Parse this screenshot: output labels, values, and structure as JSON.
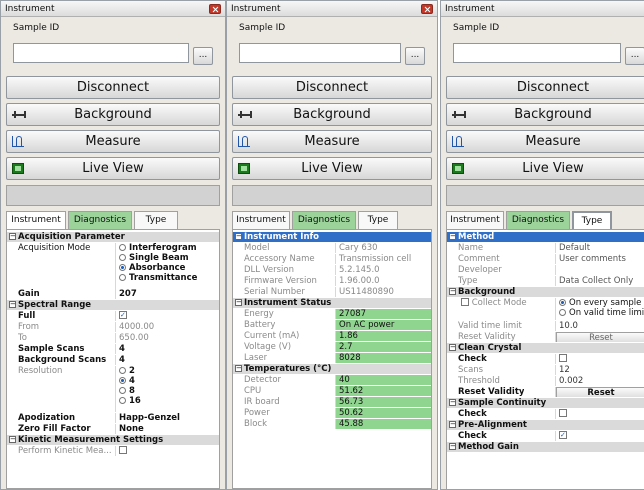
{
  "window_title": "Instrument",
  "sample_id_label": "Sample ID",
  "sample_id_value": "",
  "browse_label": "...",
  "buttons": {
    "disconnect": "Disconnect",
    "background": "Background",
    "measure": "Measure",
    "live_view": "Live View"
  },
  "tabs": {
    "instrument": "Instrument",
    "diagnostics": "Diagnostics",
    "type": "Type"
  },
  "panel1": {
    "acq_param": "Acquisition Parameter",
    "acq_mode": "Acquisition Mode",
    "mode_options": [
      "Interferogram",
      "Single Beam",
      "Absorbance",
      "Transmittance"
    ],
    "gain_label": "Gain",
    "gain_value": "207",
    "spectral_range": "Spectral Range",
    "full_label": "Full",
    "from_label": "From",
    "from_value": "4000.00",
    "to_label": "To",
    "to_value": "650.00",
    "sample_scans_label": "Sample Scans",
    "sample_scans_value": "4",
    "background_scans_label": "Background Scans",
    "background_scans_value": "4",
    "resolution_label": "Resolution",
    "resolution_options": [
      "2",
      "4",
      "8",
      "16"
    ],
    "apodization_label": "Apodization",
    "apodization_value": "Happ-Genzel",
    "zero_fill_label": "Zero Fill Factor",
    "zero_fill_value": "None",
    "kinetic": "Kinetic Measurement Settings",
    "perform_kinetic": "Perform Kinetic Mea..."
  },
  "panel2": {
    "instrument_info": "Instrument Info",
    "model_label": "Model",
    "model_value": "Cary 630",
    "accessory_label": "Accessory Name",
    "accessory_value": "Transmission cell",
    "dll_label": "DLL Version",
    "dll_value": "5.2.145.0",
    "firmware_label": "Firmware Version",
    "firmware_value": "1.96.00.0",
    "serial_label": "Serial Number",
    "serial_value": "US11480890",
    "instrument_status": "Instrument Status",
    "energy_label": "Energy",
    "energy_value": "27087",
    "battery_label": "Battery",
    "battery_value": "On AC power",
    "current_label": "Current (mA)",
    "current_value": "1.86",
    "voltage_label": "Voltage (V)",
    "voltage_value": "2.7",
    "laser_label": "Laser",
    "laser_value": "8028",
    "temperatures": "Temperatures (°C)",
    "detector_label": "Detector",
    "detector_value": "40",
    "cpu_label": "CPU",
    "cpu_value": "51.62",
    "irboard_label": "IR board",
    "irboard_value": "56.73",
    "power_label": "Power",
    "power_value": "50.62",
    "block_label": "Block",
    "block_value": "45.88"
  },
  "panel3": {
    "method": "Method",
    "name_label": "Name",
    "name_value": "Default",
    "comment_label": "Comment",
    "comment_value": "User comments",
    "developer_label": "Developer",
    "developer_value": "",
    "type_label": "Type",
    "type_value": "Data Collect Only",
    "background": "Background",
    "collect_mode_label": "Collect Mode",
    "collect_options": [
      "On every sample",
      "On valid time limit"
    ],
    "valid_time_label": "Valid time limit",
    "valid_time_value": "10.0",
    "reset_validity_label": "Reset Validity",
    "reset_label": "Reset",
    "clean_crystal": "Clean Crystal",
    "check_label": "Check",
    "scans_label": "Scans",
    "scans_value": "12",
    "threshold_label": "Threshold",
    "threshold_value": "0.002",
    "sample_continuity": "Sample Continuity",
    "pre_alignment": "Pre-Alignment",
    "method_gain": "Method Gain"
  }
}
